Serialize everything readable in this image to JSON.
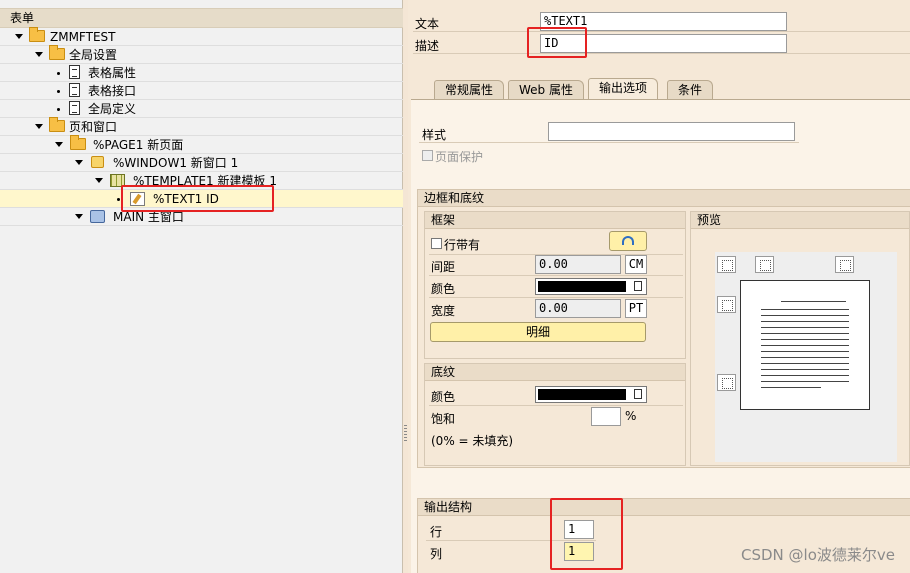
{
  "tree": {
    "header": "表单",
    "items": [
      {
        "label": "ZMMFTEST"
      },
      {
        "label": "全局设置"
      },
      {
        "label": "表格属性"
      },
      {
        "label": "表格接口"
      },
      {
        "label": "全局定义"
      },
      {
        "label": "页和窗口"
      },
      {
        "label": "%PAGE1 新页面"
      },
      {
        "label": "%WINDOW1 新窗口 1"
      },
      {
        "label": "%TEMPLATE1 新建模板 1"
      },
      {
        "label": "%TEXT1 ID"
      },
      {
        "label": "MAIN 主窗口"
      }
    ]
  },
  "header_fields": {
    "text_label": "文本",
    "text_value": "%TEXT1",
    "desc_label": "描述",
    "desc_value": "ID"
  },
  "tabs": [
    {
      "label": "常规属性"
    },
    {
      "label": "Web 属性"
    },
    {
      "label": "输出选项",
      "active": true
    },
    {
      "label": "条件"
    }
  ],
  "output_options": {
    "style_label": "样式",
    "style_value": "",
    "page_protect_label": "页面保护",
    "border_group": {
      "title": "边框和底纹",
      "frame": {
        "title": "框架",
        "with_line_label": "行带有",
        "spacing_label": "间距",
        "spacing_value": "0.00",
        "spacing_unit": "CM",
        "color_label": "颜色",
        "width_label": "宽度",
        "width_value": "0.00",
        "width_unit": "PT",
        "details_button": "明细"
      },
      "shading": {
        "title": "底纹",
        "color_label": "颜色",
        "saturation_label": "饱和",
        "saturation_unit": "%",
        "note": "(0% = 未填充)"
      },
      "preview_title": "预览"
    },
    "output_structure": {
      "title": "输出结构",
      "row_label": "行",
      "row_value": "1",
      "col_label": "列",
      "col_value": "1"
    }
  },
  "watermark": "CSDN @lo波德莱尔ve",
  "colors": {
    "highlight": "#e52222",
    "tab_bg": "#e7dac6"
  }
}
